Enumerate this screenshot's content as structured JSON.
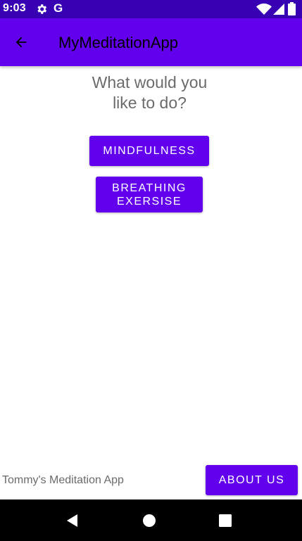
{
  "status_bar": {
    "time": "9:03",
    "g_label": "G",
    "icons": [
      "gear-icon",
      "google-icon",
      "wifi-icon",
      "signal-icon",
      "battery-icon"
    ],
    "color": "#3700B3"
  },
  "app_bar": {
    "title": "MyMeditationApp",
    "back_icon": "back-arrow-icon",
    "color": "#6200EE"
  },
  "main": {
    "question_line1": "What would you",
    "question_line2": "like to do?",
    "mindfulness_label": "MINDFULNESS",
    "breathing_label_line1": "BREATHING",
    "breathing_label_line2": "EXERSISE",
    "button_color": "#6200EE"
  },
  "footer": {
    "app_name": "Tommy's Meditation App",
    "about_label": "ABOUT US"
  },
  "nav_bar": {
    "icons": [
      "nav-back-icon",
      "nav-home-icon",
      "nav-recents-icon"
    ]
  }
}
